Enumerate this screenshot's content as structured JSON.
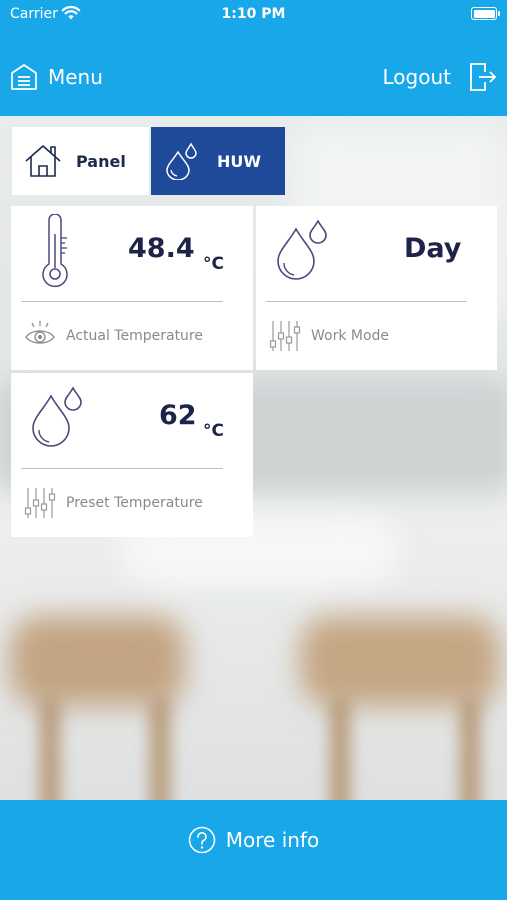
{
  "status_bar": {
    "carrier": "Carrier",
    "time": "1:10 PM"
  },
  "header": {
    "menu_label": "Menu",
    "logout_label": "Logout"
  },
  "tabs": [
    {
      "label": "Panel",
      "icon": "house-icon",
      "active": false
    },
    {
      "label": "HUW",
      "icon": "water-drops-icon",
      "active": true
    }
  ],
  "cards": {
    "actual_temperature": {
      "value": "48.4",
      "unit": "°C",
      "caption": "Actual Temperature",
      "icon": "thermometer-icon",
      "caption_icon": "eye-icon"
    },
    "work_mode": {
      "value": "Day",
      "caption": "Work Mode",
      "icon": "water-drops-icon",
      "caption_icon": "sliders-icon"
    },
    "preset_temperature": {
      "value": "62",
      "unit": "°C",
      "caption": "Preset Temperature",
      "icon": "water-drops-icon",
      "caption_icon": "sliders-icon"
    }
  },
  "footer": {
    "label": "More info",
    "icon": "question-circle-icon"
  },
  "colors": {
    "primary": "#18a7e9",
    "active_tab": "#1f4a9a",
    "text_dark": "#1d2447",
    "icon_stroke": "#4a4a7a"
  }
}
